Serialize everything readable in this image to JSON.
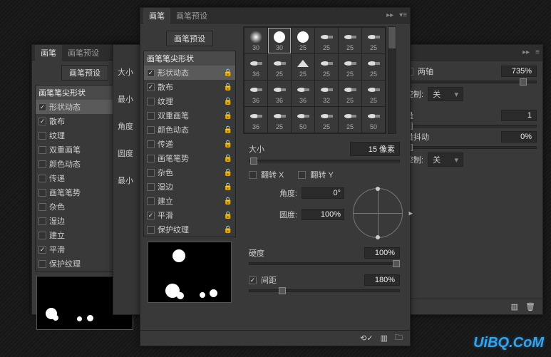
{
  "tabs": {
    "brush": "画笔",
    "preset": "画笔预设"
  },
  "preset_button": "画笔预设",
  "list": {
    "header": "画笔笔尖形状",
    "items": [
      {
        "label": "形状动态",
        "checked": true,
        "selected": true,
        "lock": true
      },
      {
        "label": "散布",
        "checked": true,
        "lock": true
      },
      {
        "label": "纹理",
        "checked": false,
        "lock": true
      },
      {
        "label": "双重画笔",
        "checked": false,
        "lock": true
      },
      {
        "label": "颜色动态",
        "checked": false,
        "lock": true
      },
      {
        "label": "传递",
        "checked": false,
        "lock": true
      },
      {
        "label": "画笔笔势",
        "checked": false,
        "lock": true
      },
      {
        "label": "杂色",
        "checked": false,
        "lock": true
      },
      {
        "label": "湿边",
        "checked": false,
        "lock": true
      },
      {
        "label": "建立",
        "checked": false,
        "lock": true
      },
      {
        "label": "平滑",
        "checked": true,
        "lock": true
      },
      {
        "label": "保护纹理",
        "checked": false,
        "lock": true
      }
    ]
  },
  "brush_grid": {
    "rows": [
      [
        {
          "s": 30,
          "t": "soft"
        },
        {
          "s": 30,
          "t": "hard",
          "sel": true
        },
        {
          "s": 25,
          "t": "hard"
        },
        {
          "s": 25,
          "t": "flat"
        },
        {
          "s": 25,
          "t": "flat"
        },
        {
          "s": 25,
          "t": "flat"
        }
      ],
      [
        {
          "s": 36,
          "t": "flat"
        },
        {
          "s": 25,
          "t": "flat"
        },
        {
          "s": 25,
          "t": "fan"
        },
        {
          "s": 25,
          "t": "flat"
        },
        {
          "s": 25,
          "t": "flat"
        },
        {
          "s": 25,
          "t": "flat"
        }
      ],
      [
        {
          "s": 36,
          "t": "flat"
        },
        {
          "s": 36,
          "t": "flat"
        },
        {
          "s": 36,
          "t": "flat"
        },
        {
          "s": 32,
          "t": "flat"
        },
        {
          "s": 25,
          "t": "flat"
        },
        {
          "s": 25,
          "t": "flat"
        }
      ],
      [
        {
          "s": 36,
          "t": "flat"
        },
        {
          "s": 25,
          "t": "flat"
        },
        {
          "s": 50,
          "t": "flat"
        },
        {
          "s": 25,
          "t": "flat"
        },
        {
          "s": 25,
          "t": "flat"
        },
        {
          "s": 50,
          "t": "flat"
        }
      ]
    ]
  },
  "size": {
    "label": "大小",
    "value": "15 像素"
  },
  "flip": {
    "x": "翻转 X",
    "y": "翻转 Y"
  },
  "angle": {
    "label": "角度:",
    "value": "0°"
  },
  "roundness": {
    "label": "圆度:",
    "value": "100%"
  },
  "hardness": {
    "label": "硬度",
    "value": "100%"
  },
  "spacing": {
    "label": "间距",
    "value": "180%",
    "checked": true
  },
  "right": {
    "twoaxis": {
      "label": "两轴",
      "value": "735%"
    },
    "control1": {
      "label": "控制:",
      "value": "关"
    },
    "count": {
      "label": "量",
      "value": "1"
    },
    "jitter": {
      "label": "量抖动",
      "value": "0%"
    },
    "control2": {
      "label": "控制:",
      "value": "关"
    }
  },
  "bg_left": {
    "size_lbl": "大小",
    "min_lbl": "最小",
    "angle_lbl": "角度",
    "round_lbl": "圆度",
    "min2_lbl": "最小"
  },
  "logo": "UiBQ.CoM"
}
